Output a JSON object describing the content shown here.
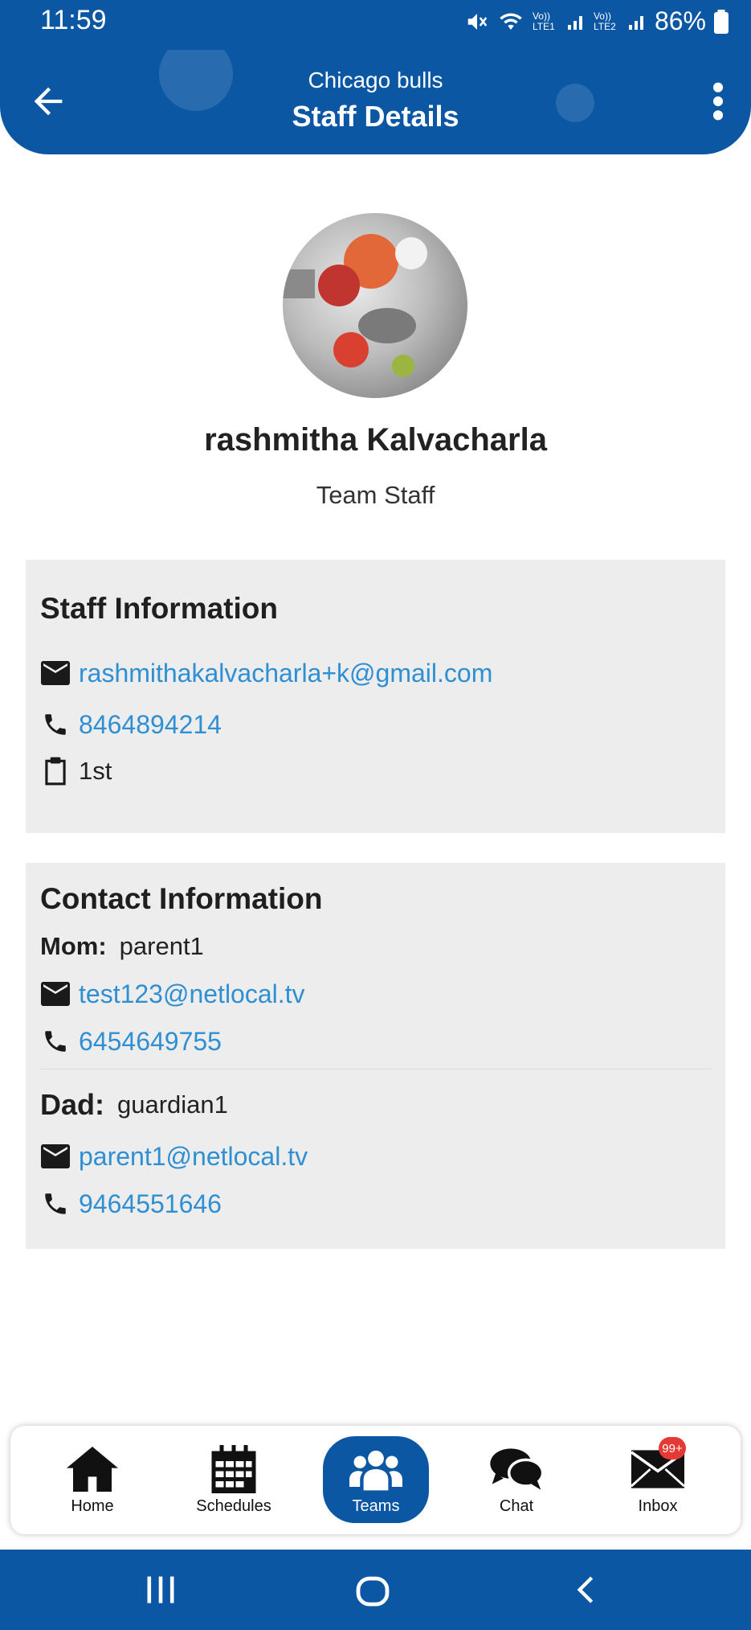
{
  "status_bar": {
    "time": "11:59",
    "battery": "86%",
    "sim1": "Vo)) LTE1",
    "sim2": "Vo)) LTE2"
  },
  "header": {
    "subtitle": "Chicago bulls",
    "title": "Staff Details"
  },
  "profile": {
    "name": "rashmitha Kalvacharla",
    "role": "Team Staff"
  },
  "staff_info": {
    "title": "Staff Information",
    "email": "rashmithakalvacharla+k@gmail.com",
    "phone": "8464894214",
    "jersey": "1st"
  },
  "contact_info": {
    "title": "Contact Information",
    "contacts": [
      {
        "relation": "Mom:",
        "name": "parent1",
        "email": "test123@netlocal.tv",
        "phone": "6454649755"
      },
      {
        "relation": "Dad:",
        "name": "guardian1",
        "email": "parent1@netlocal.tv",
        "phone": "9464551646"
      }
    ]
  },
  "bottom_nav": {
    "items": [
      {
        "label": "Home",
        "icon": "home-icon"
      },
      {
        "label": "Schedules",
        "icon": "calendar-icon"
      },
      {
        "label": "Teams",
        "icon": "teams-icon",
        "active": true
      },
      {
        "label": "Chat",
        "icon": "chat-icon"
      },
      {
        "label": "Inbox",
        "icon": "mail-icon",
        "badge": "99+"
      }
    ]
  },
  "colors": {
    "primary": "#0b57a4",
    "link": "#2f8fd3",
    "card_bg": "#ededed",
    "badge": "#e53935"
  }
}
